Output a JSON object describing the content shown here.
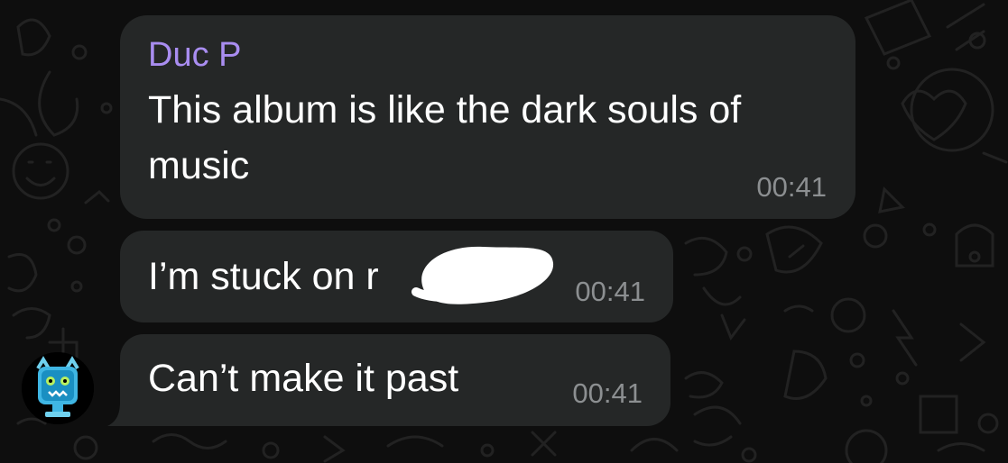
{
  "messages": [
    {
      "sender": "Duc P",
      "text": "This album is like the dark souls of music",
      "time": "00:41"
    },
    {
      "text": "I’m stuck on r",
      "time": "00:41",
      "redacted": true
    },
    {
      "text": "Can’t make it past",
      "time": "00:41"
    }
  ],
  "colors": {
    "background": "#0e0e0e",
    "bubble": "#252727",
    "sender_name": "#a98df0",
    "timestamp": "#8c8f91",
    "text": "#ffffff"
  },
  "icons": [
    "chat-wallpaper-doodle-pattern",
    "devil-cat-avatar-icon",
    "redaction-scribble"
  ]
}
